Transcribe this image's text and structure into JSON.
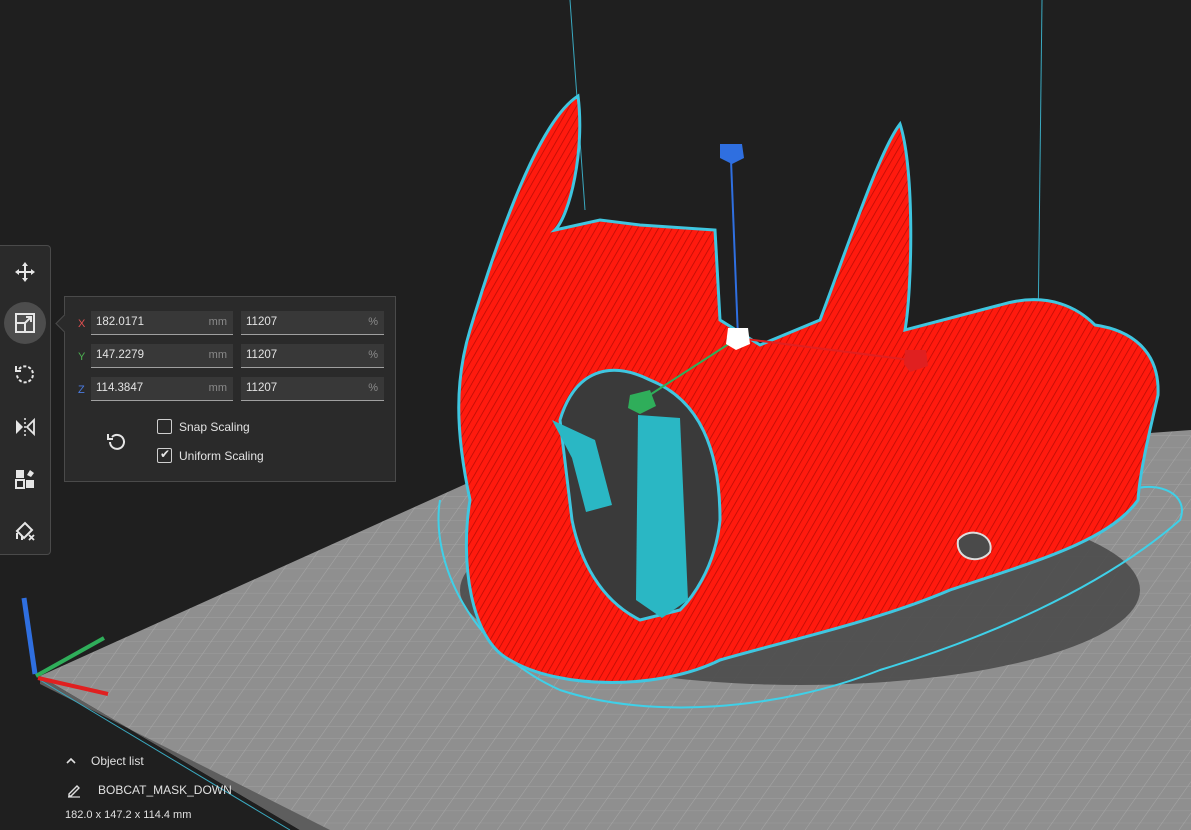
{
  "tools": [
    {
      "name": "move-tool-button",
      "icon": "move-icon"
    },
    {
      "name": "scale-tool-button",
      "icon": "scale-icon",
      "active": true
    },
    {
      "name": "rotate-tool-button",
      "icon": "rotate-icon"
    },
    {
      "name": "mirror-tool-button",
      "icon": "mirror-icon"
    },
    {
      "name": "per-model-settings-button",
      "icon": "per-model-settings-icon"
    },
    {
      "name": "support-blocker-button",
      "icon": "support-blocker-icon"
    }
  ],
  "scale_panel": {
    "rows": [
      {
        "axis": "X",
        "axis_color": "#e05050",
        "size": "182.0171",
        "size_unit": "mm",
        "percent": "11207",
        "percent_unit": "%"
      },
      {
        "axis": "Y",
        "axis_color": "#4caf50",
        "size": "147.2279",
        "size_unit": "mm",
        "percent": "11207",
        "percent_unit": "%"
      },
      {
        "axis": "Z",
        "axis_color": "#4a7be0",
        "size": "114.3847",
        "size_unit": "mm",
        "percent": "11207",
        "percent_unit": "%"
      }
    ],
    "snap_scaling": {
      "label": "Snap Scaling",
      "checked": false
    },
    "uniform_scaling": {
      "label": "Uniform Scaling",
      "checked": true
    },
    "reset_icon": "reset-icon"
  },
  "object_list": {
    "toggle_label": "Object list",
    "object_name": "BOBCAT_MASK_DOWN",
    "dimensions": "182.0 x 147.2 x 114.4 mm",
    "edit_icon": "pencil-icon"
  },
  "colors": {
    "model": "#ff1a0e",
    "model_outline": "#3fc6e0",
    "support": "#2ab7c4",
    "build_plate": "#9a9a9a",
    "background": "#1f1f1f"
  }
}
